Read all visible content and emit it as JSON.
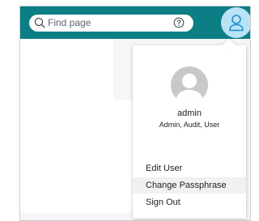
{
  "search": {
    "placeholder": "Find page"
  },
  "user_menu": {
    "username": "admin",
    "roles": "Admin, Audit, User",
    "items": [
      {
        "label": "Edit User"
      },
      {
        "label": "Change Passphrase"
      },
      {
        "label": "Sign Out"
      }
    ]
  },
  "colors": {
    "header": "#0b7e86",
    "avatar_bg": "#b9e3f5",
    "avatar_icon": "#1b8fc9",
    "highlight": "#f0f1f2"
  },
  "icons": {
    "search": "search-icon",
    "help": "help-icon",
    "user": "user-icon",
    "profile": "profile-avatar-icon"
  }
}
